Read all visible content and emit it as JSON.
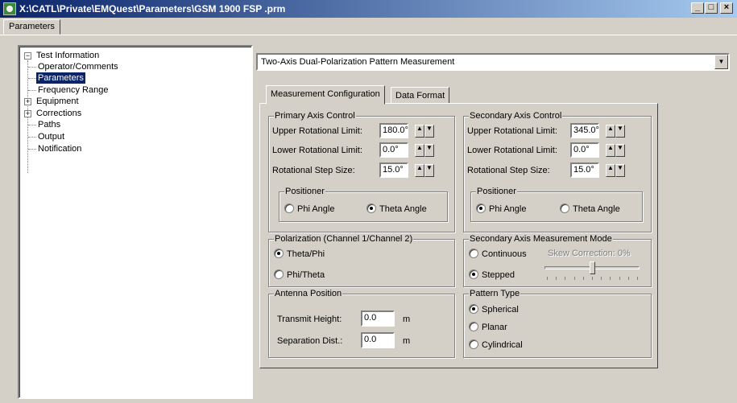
{
  "window": {
    "title": "X:\\CATL\\Private\\EMQuest\\Parameters\\GSM 1900 FSP .prm",
    "controls": {
      "minimize": "_",
      "maximize": "□",
      "close": "×"
    }
  },
  "top_tab": {
    "label": "Parameters"
  },
  "tree": {
    "root": {
      "label": "Test Information",
      "expander": "−"
    },
    "items": [
      {
        "label": "Operator/Comments",
        "expander": "",
        "selected": false
      },
      {
        "label": "Parameters",
        "expander": "",
        "selected": true
      },
      {
        "label": "Frequency Range",
        "expander": "",
        "selected": false
      },
      {
        "label": "Equipment",
        "expander": "+",
        "selected": false
      },
      {
        "label": "Corrections",
        "expander": "+",
        "selected": false
      },
      {
        "label": "Paths",
        "expander": "",
        "selected": false
      },
      {
        "label": "Output",
        "expander": "",
        "selected": false
      },
      {
        "label": "Notification",
        "expander": "",
        "selected": false
      }
    ]
  },
  "measurement_type": {
    "selected": "Two-Axis Dual-Polarization Pattern Measurement",
    "arrow": "▼"
  },
  "tabs": {
    "measurement_configuration": "Measurement Configuration",
    "data_format": "Data Format"
  },
  "spin_arrows": {
    "up": "▲",
    "down": "▼"
  },
  "primary_axis": {
    "title": "Primary Axis Control",
    "upper_label": "Upper Rotational Limit:",
    "upper_value": "180.0°",
    "lower_label": "Lower Rotational Limit:",
    "lower_value": "0.0°",
    "step_label": "Rotational Step Size:",
    "step_value": "15.0°",
    "positioner": {
      "title": "Positioner",
      "phi": "Phi Angle",
      "theta": "Theta Angle",
      "selected": "Theta Angle"
    }
  },
  "secondary_axis": {
    "title": "Secondary Axis Control",
    "upper_label": "Upper Rotational Limit:",
    "upper_value": "345.0°",
    "lower_label": "Lower Rotational Limit:",
    "lower_value": "0.0°",
    "step_label": "Rotational Step Size:",
    "step_value": "15.0°",
    "positioner": {
      "title": "Positioner",
      "phi": "Phi Angle",
      "theta": "Theta Angle",
      "selected": "Phi Angle"
    }
  },
  "polarization": {
    "title": "Polarization (Channel 1/Channel 2)",
    "options": [
      "Theta/Phi",
      "Phi/Theta"
    ],
    "selected": "Theta/Phi"
  },
  "secondary_mode": {
    "title": "Secondary Axis Measurement Mode",
    "continuous": "Continuous",
    "stepped": "Stepped",
    "selected": "Stepped",
    "skew_label": "Skew Correction: 0%",
    "skew_slider_level": 0.5
  },
  "antenna_position": {
    "title": "Antenna Position",
    "transmit_label": "Transmit Height:",
    "transmit_value": "0.0",
    "transmit_unit": "m",
    "separation_label": "Separation Dist.:",
    "separation_value": "0.0",
    "separation_unit": "m"
  },
  "pattern_type": {
    "title": "Pattern Type",
    "options": [
      "Spherical",
      "Planar",
      "Cylindrical"
    ],
    "selected": "Spherical"
  }
}
